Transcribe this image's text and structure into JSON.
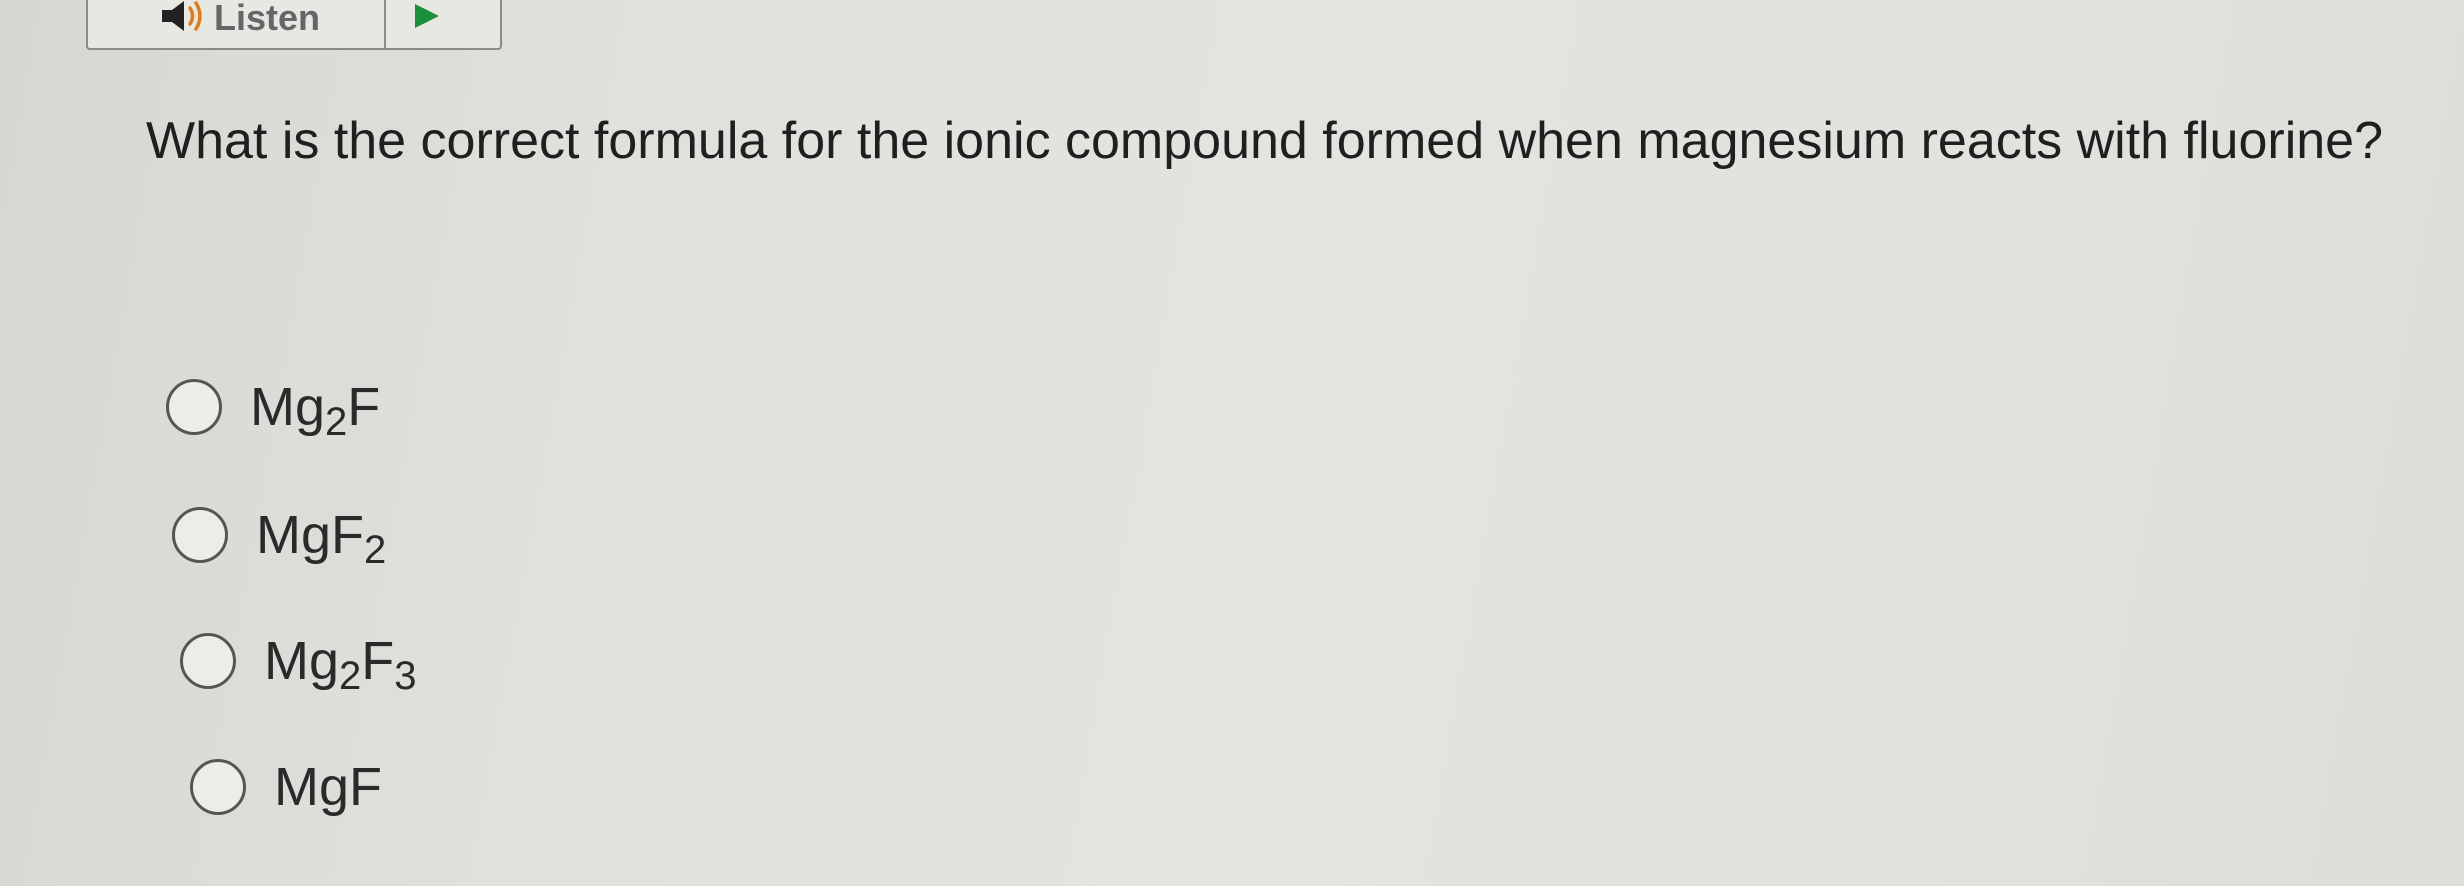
{
  "toolbar": {
    "listen_label": "Listen",
    "listen_icon": "speaker-icon",
    "play_icon": "play-icon"
  },
  "question": {
    "text": "What is the correct formula for the ionic compound formed when magnesium reacts with fluorine?"
  },
  "options": [
    {
      "parts": [
        {
          "t": "Mg"
        },
        {
          "t": "2",
          "sub": true
        },
        {
          "t": "F"
        }
      ],
      "selected": false
    },
    {
      "parts": [
        {
          "t": "MgF"
        },
        {
          "t": "2",
          "sub": true
        }
      ],
      "selected": false
    },
    {
      "parts": [
        {
          "t": "Mg"
        },
        {
          "t": "2",
          "sub": true
        },
        {
          "t": "F"
        },
        {
          "t": "3",
          "sub": true
        }
      ],
      "selected": false
    },
    {
      "parts": [
        {
          "t": "MgF"
        }
      ],
      "selected": false
    }
  ]
}
